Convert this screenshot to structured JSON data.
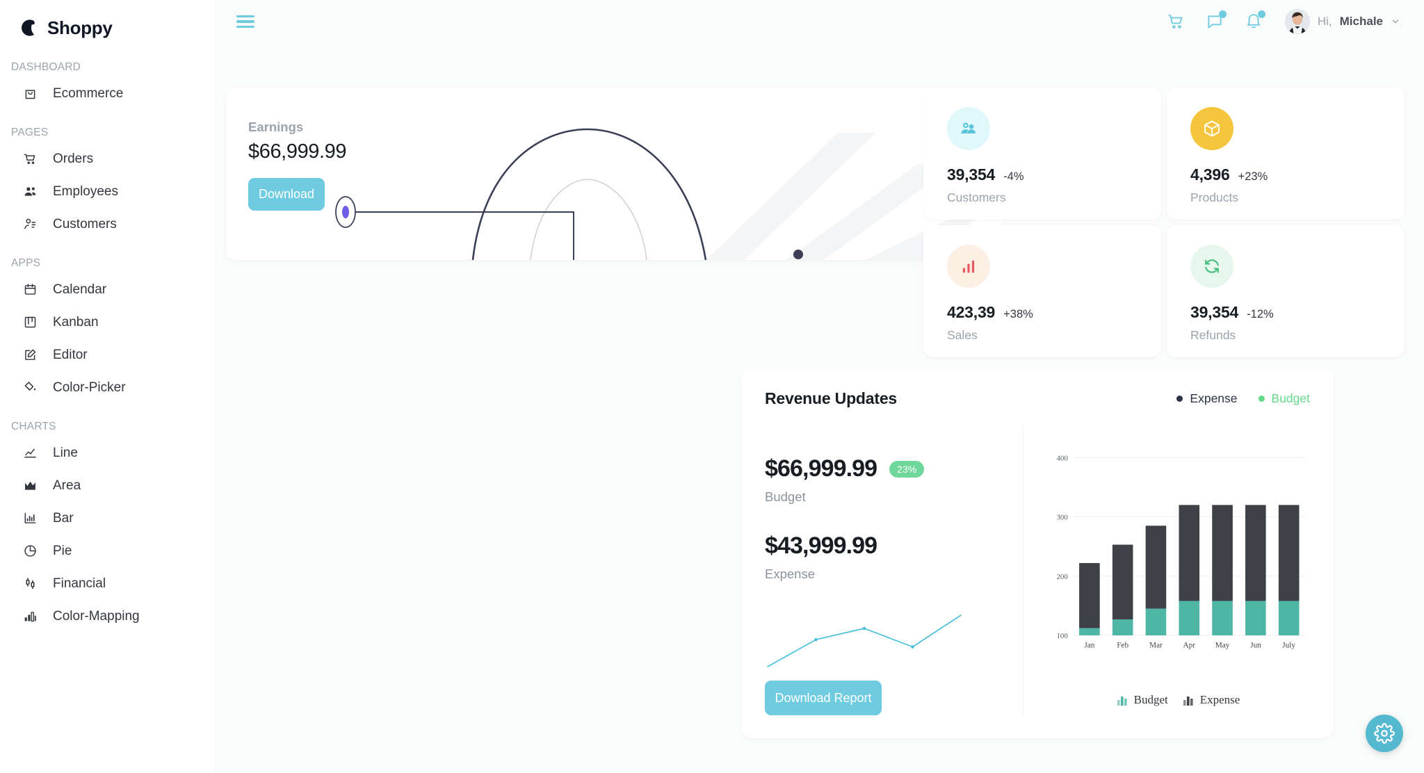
{
  "brand": {
    "name": "Shoppy",
    "logo_icon": "crescent-logo-icon"
  },
  "sidebar": {
    "groups": [
      {
        "label": "DASHBOARD",
        "items": [
          {
            "label": "Ecommerce",
            "icon": "shopping-bag-icon"
          }
        ]
      },
      {
        "label": "PAGES",
        "items": [
          {
            "label": "Orders",
            "icon": "shopping-cart-icon"
          },
          {
            "label": "Employees",
            "icon": "employees-icon"
          },
          {
            "label": "Customers",
            "icon": "customer-person-icon"
          }
        ]
      },
      {
        "label": "APPS",
        "items": [
          {
            "label": "Calendar",
            "icon": "calendar-icon"
          },
          {
            "label": "Kanban",
            "icon": "kanban-board-icon"
          },
          {
            "label": "Editor",
            "icon": "edit-pencil-icon"
          },
          {
            "label": "Color-Picker",
            "icon": "color-picker-icon"
          }
        ]
      },
      {
        "label": "CHARTS",
        "items": [
          {
            "label": "Line",
            "icon": "line-chart-icon"
          },
          {
            "label": "Area",
            "icon": "area-chart-icon"
          },
          {
            "label": "Bar",
            "icon": "bar-chart-icon"
          },
          {
            "label": "Pie",
            "icon": "pie-chart-icon"
          },
          {
            "label": "Financial",
            "icon": "financial-candlestick-icon"
          },
          {
            "label": "Color-Mapping",
            "icon": "color-mapping-icon"
          }
        ]
      }
    ]
  },
  "topbar": {
    "menu_icon": "hamburger-menu-icon",
    "icons": [
      {
        "name": "cart-icon",
        "badge": false
      },
      {
        "name": "chat-icon",
        "badge": true
      },
      {
        "name": "notification-bell-icon",
        "badge": true
      }
    ],
    "greeting": "Hi,",
    "username": "Michale",
    "chevron_icon": "chevron-down-icon"
  },
  "earnings": {
    "label": "Earnings",
    "value": "$66,999.99",
    "download_label": "Download",
    "accent": "#6ecbe0"
  },
  "stats": [
    {
      "value": "39,354",
      "delta": "-4%",
      "caption": "Customers",
      "icon": "customers-group-icon",
      "bg": "#e0f7fb",
      "fg": "#59c3d8"
    },
    {
      "value": "4,396",
      "delta": "+23%",
      "caption": "Products",
      "icon": "package-box-icon",
      "bg": "#f5c53d",
      "fg": "#ffffff"
    },
    {
      "value": "423,39",
      "delta": "+38%",
      "caption": "Sales",
      "icon": "bars-up-icon",
      "bg": "#fcefe3",
      "fg": "#e8585f"
    },
    {
      "value": "39,354",
      "delta": "-12%",
      "caption": "Refunds",
      "icon": "refresh-refund-icon",
      "bg": "#e7f7ee",
      "fg": "#4bbd7f"
    }
  ],
  "revenue": {
    "title": "Revenue Updates",
    "legend": [
      {
        "label": "Expense",
        "color": "#2b3445"
      },
      {
        "label": "Budget",
        "color": "#64d98a"
      }
    ],
    "budget": {
      "amount": "$66,999.99",
      "caption": "Budget",
      "pill": "23%"
    },
    "expense": {
      "amount": "$43,999.99",
      "caption": "Expense"
    },
    "download_label": "Download Report"
  },
  "chart_data": {
    "type": "bar",
    "title": "Revenue Updates",
    "stacked": true,
    "categories": [
      "Jan",
      "Feb",
      "Mar",
      "Apr",
      "May",
      "Jun",
      "July"
    ],
    "series": [
      {
        "name": "Budget",
        "color": "#4fb5a5",
        "values": [
          112,
          127,
          145,
          158,
          158,
          158,
          158
        ]
      },
      {
        "name": "Expense",
        "color": "#3d4044",
        "values": [
          110,
          126,
          140,
          162,
          162,
          162,
          162
        ]
      }
    ],
    "totals": [
      222,
      253,
      285,
      320,
      320,
      320,
      320
    ],
    "yticks": [
      100,
      200,
      300,
      400
    ],
    "ylim": [
      100,
      400
    ],
    "xlabel": "",
    "ylabel": "",
    "grid": true,
    "legend_position": "bottom",
    "legend_entries": [
      "Budget",
      "Expense"
    ]
  },
  "sparkline": {
    "type": "line",
    "color": "#4cc0da",
    "values": [
      14,
      55,
      72,
      44,
      92
    ],
    "x": [
      0,
      1,
      2,
      3,
      4
    ]
  },
  "fab": {
    "icon": "settings-gear-icon",
    "color": "#55b9cf"
  }
}
